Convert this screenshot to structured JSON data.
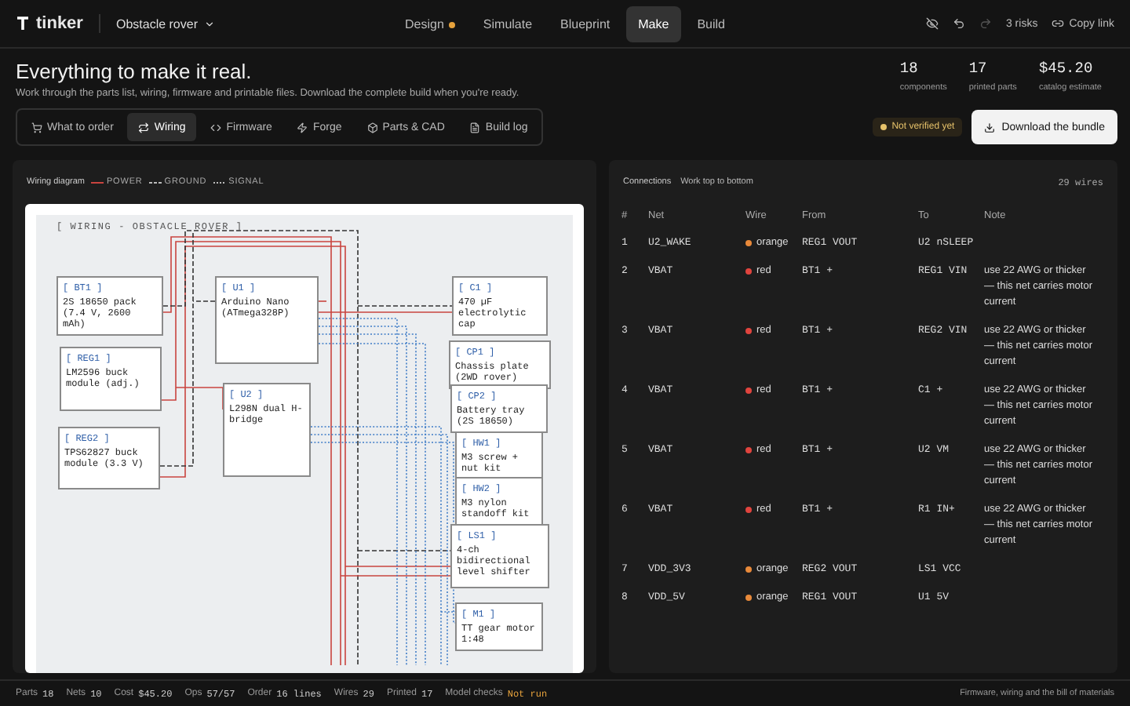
{
  "app": {
    "logo": "tinker",
    "project": "Obstacle rover"
  },
  "nav": [
    {
      "label": "Design",
      "selected": false,
      "modified": true
    },
    {
      "label": "Simulate",
      "selected": false,
      "modified": false
    },
    {
      "label": "Blueprint",
      "selected": false,
      "modified": false
    },
    {
      "label": "Make",
      "selected": true,
      "modified": false
    },
    {
      "label": "Build",
      "selected": false,
      "modified": false
    }
  ],
  "toolbar": {
    "redo_disabled": true,
    "risks": "3 risks",
    "copy_link": "Copy link"
  },
  "header": {
    "title": "Everything to make it real.",
    "subtitle": "Work through the parts list, wiring, firmware and printable files. Download the complete build when you're ready.",
    "stats": [
      {
        "value": "18",
        "label": "components"
      },
      {
        "value": "17",
        "label": "printed parts"
      },
      {
        "value": "$45.20",
        "label": "catalog estimate"
      }
    ]
  },
  "tabs": [
    {
      "label": "What to order",
      "selected": false
    },
    {
      "label": "Wiring",
      "selected": true
    },
    {
      "label": "Firmware",
      "selected": false
    },
    {
      "label": "Forge",
      "selected": false
    },
    {
      "label": "Parts & CAD",
      "selected": false
    },
    {
      "label": "Build log",
      "selected": false
    }
  ],
  "verify_badge": "Not verified yet",
  "download_button": "Download the bundle",
  "diagram": {
    "title": "Wiring diagram",
    "legend": [
      {
        "kind": "power",
        "label": "POWER"
      },
      {
        "kind": "ground",
        "label": "GROUND"
      },
      {
        "kind": "signal",
        "label": "SIGNAL"
      }
    ],
    "heading": "[ WIRING - OBSTACLE ROVER ]",
    "blocks": [
      {
        "ref": "[ BT1 ]",
        "desc": "2S 18650 pack (7.4 V, 2600 mAh)"
      },
      {
        "ref": "[ U1 ]",
        "desc": "Arduino Nano (ATmega328P)"
      },
      {
        "ref": "[ C1 ]",
        "desc": "470 µF electrolytic cap"
      },
      {
        "ref": "[ REG1 ]",
        "desc": "LM2596 buck module (adj.)"
      },
      {
        "ref": "[ U2 ]",
        "desc": "L298N dual H-bridge"
      },
      {
        "ref": "[ CP1 ]",
        "desc": "Chassis plate (2WD rover)"
      },
      {
        "ref": "[ REG2 ]",
        "desc": "TPS62827 buck module (3.3 V)"
      },
      {
        "ref": "[ CP2 ]",
        "desc": "Battery tray (2S 18650)"
      },
      {
        "ref": "[ HW1 ]",
        "desc": "M3 screw + nut kit"
      },
      {
        "ref": "[ HW2 ]",
        "desc": "M3 nylon standoff kit"
      },
      {
        "ref": "[ LS1 ]",
        "desc": "4-ch bidirectional level shifter"
      },
      {
        "ref": "[ M1 ]",
        "desc": "TT gear motor 1:48"
      }
    ]
  },
  "connections": {
    "title": "Connections",
    "hint": "Work top to bottom",
    "count": "29 wires",
    "columns": [
      "#",
      "Net",
      "Wire",
      "From",
      "To",
      "Note"
    ],
    "rows": [
      {
        "n": "1",
        "net": "U2_WAKE",
        "wire": "orange",
        "color": "#e8893a",
        "from": "REG1 VOUT",
        "to": "U2 nSLEEP"
      },
      {
        "n": "2",
        "net": "VBAT",
        "wire": "red",
        "color": "#e0443e",
        "from": "BT1 +",
        "to": "REG1 VIN",
        "note": "use 22 AWG or thicker — this net carries motor current"
      },
      {
        "n": "3",
        "net": "VBAT",
        "wire": "red",
        "color": "#e0443e",
        "from": "BT1 +",
        "to": "REG2 VIN",
        "note": "use 22 AWG or thicker — this net carries motor current"
      },
      {
        "n": "4",
        "net": "VBAT",
        "wire": "red",
        "color": "#e0443e",
        "from": "BT1 +",
        "to": "C1 +",
        "note": "use 22 AWG or thicker — this net carries motor current"
      },
      {
        "n": "5",
        "net": "VBAT",
        "wire": "red",
        "color": "#e0443e",
        "from": "BT1 +",
        "to": "U2 VM",
        "note": "use 22 AWG or thicker — this net carries motor current"
      },
      {
        "n": "6",
        "net": "VBAT",
        "wire": "red",
        "color": "#e0443e",
        "from": "BT1 +",
        "to": "R1 IN+",
        "note": "use 22 AWG or thicker — this net carries motor current"
      },
      {
        "n": "7",
        "net": "VDD_3V3",
        "wire": "orange",
        "color": "#e8893a",
        "from": "REG2 VOUT",
        "to": "LS1 VCC"
      },
      {
        "n": "8",
        "net": "VDD_5V",
        "wire": "orange",
        "color": "#e8893a",
        "from": "REG1 VOUT",
        "to": "U1 5V"
      }
    ]
  },
  "status_bar": {
    "items": [
      {
        "label": "Parts",
        "value": "18",
        "kind": "normal"
      },
      {
        "label": "Nets",
        "value": "10",
        "kind": "normal"
      },
      {
        "label": "Cost",
        "value": "$45.20",
        "kind": "normal"
      },
      {
        "label": "Ops",
        "value": "57/57",
        "kind": "normal"
      },
      {
        "label": "Order",
        "value": "16 lines",
        "kind": "normal"
      },
      {
        "label": "Wires",
        "value": "29",
        "kind": "normal"
      },
      {
        "label": "Printed",
        "value": "17",
        "kind": "normal"
      },
      {
        "label": "Model checks",
        "value": "Not run",
        "kind": "warning"
      }
    ],
    "right": "Firmware, wiring and the bill of materials"
  }
}
